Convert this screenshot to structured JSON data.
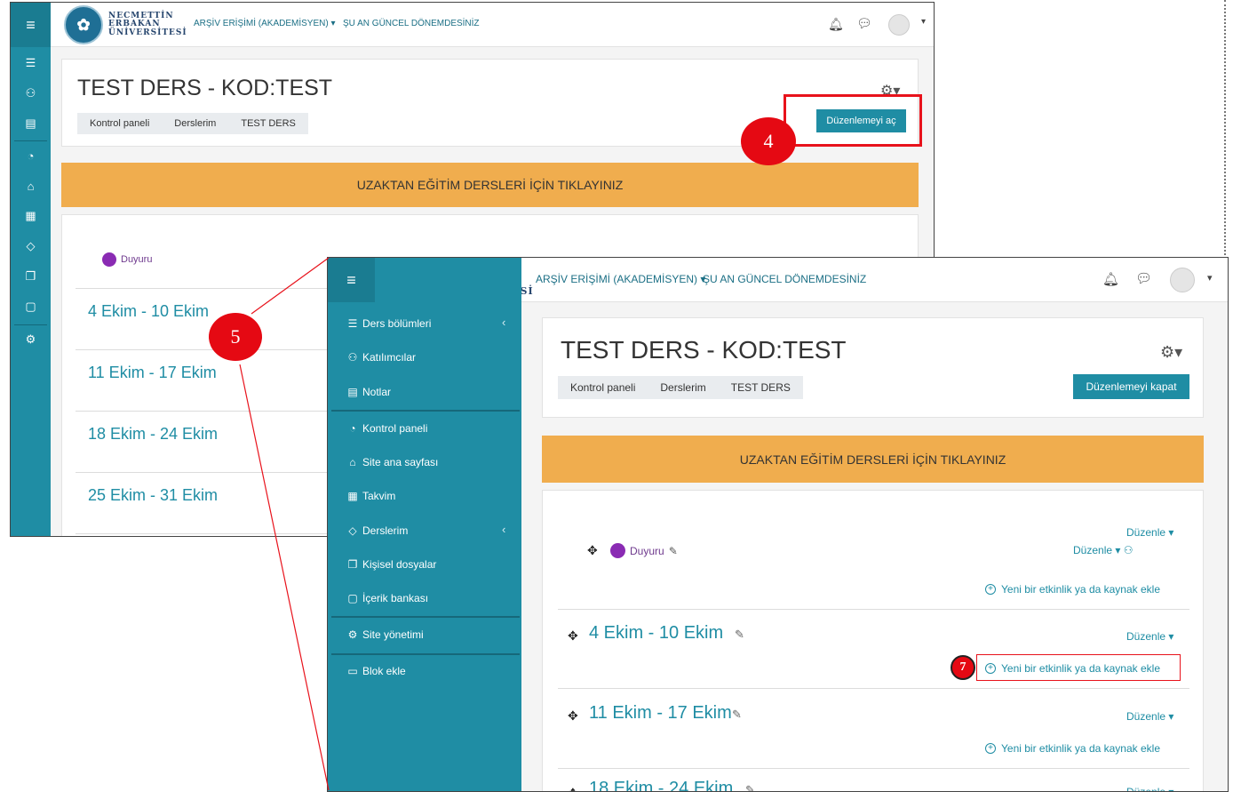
{
  "app": {
    "menu_icon": "menu-icon",
    "university": [
      "NECMETTİN",
      "ERBAKAN",
      "ÜNİVERSİTESİ"
    ],
    "archive_link": "ARŞİV ERİŞİMİ (AKADEMİSYEN)",
    "archive_caret": "▾",
    "term_link": "ŞU AN GÜNCEL DÖNEMDESİNİZ"
  },
  "course": {
    "title": "TEST DERS - KOD:TEST",
    "breadcrumb": [
      "Kontrol paneli",
      "Derslerim",
      "TEST DERS"
    ],
    "banner": "UZAKTAN EĞİTİM DERSLERİ İÇİN TIKLAYINIZ",
    "announcement": "Duyuru",
    "weeks": [
      "4 Ekim - 10 Ekim",
      "11 Ekim - 17 Ekim",
      "18 Ekim - 24 Ekim",
      "25 Ekim - 31 Ekim"
    ]
  },
  "screenshot1": {
    "edit_button": "Düzenlemeyi aç"
  },
  "screenshot2": {
    "edit_button": "Düzenlemeyi kapat",
    "edit_menu": "Düzenle",
    "edit_caret": "▾",
    "add_activity": "Yeni bir etkinlik ya da kaynak ekle",
    "drawer": [
      {
        "label": "Ders bölümleri",
        "icon": "list-icon"
      },
      {
        "label": "Katılımcılar",
        "icon": "users-icon"
      },
      {
        "label": "Notlar",
        "icon": "grades-icon"
      },
      {
        "label": "Kontrol paneli",
        "icon": "dashboard-icon"
      },
      {
        "label": "Site ana sayfası",
        "icon": "home-icon"
      },
      {
        "label": "Takvim",
        "icon": "calendar-icon"
      },
      {
        "label": "Derslerim",
        "icon": "graduation-cap-icon"
      },
      {
        "label": "Kişisel dosyalar",
        "icon": "files-icon"
      },
      {
        "label": "İçerik bankası",
        "icon": "clipboard-icon"
      },
      {
        "label": "Site yönetimi",
        "icon": "gear-icon"
      },
      {
        "label": "Blok ekle",
        "icon": "folder-icon"
      }
    ]
  },
  "callouts": {
    "step_4": "4",
    "step_5": "5",
    "step_7": "7"
  },
  "colors": {
    "primary": "#1f8da4",
    "banner": "#f0ad4e",
    "callout": "#e8121b",
    "announcement": "#8a2bb3"
  }
}
